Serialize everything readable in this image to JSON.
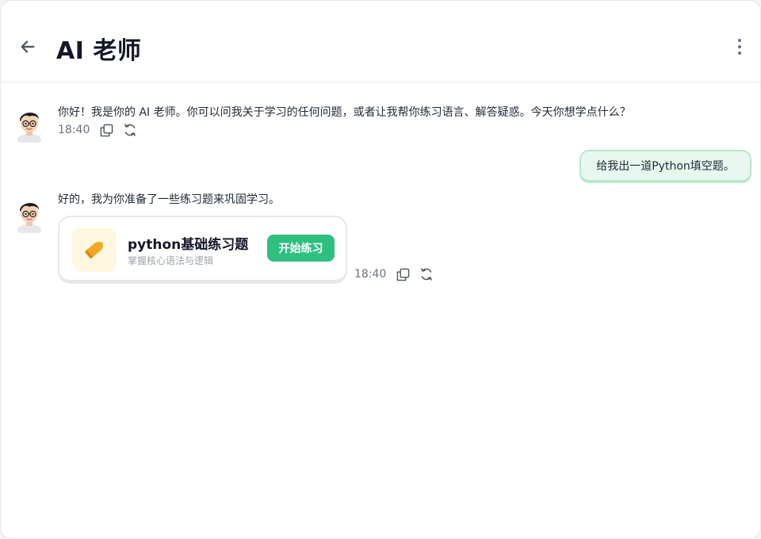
{
  "header": {
    "title": "AI 老师"
  },
  "messages": {
    "ai_1": {
      "text": "你好！我是你的 AI 老师。你可以问我关于学习的任何问题，或者让我帮你练习语言、解答疑惑。今天你想学点什么？",
      "time": "18:40"
    },
    "user_1": {
      "text": "给我出一道Python填空题。"
    },
    "ai_2": {
      "text": "好的，我为你准备了一些练习题来巩固学习。",
      "time": "18:40",
      "card": {
        "title": "python基础练习题",
        "subtitle": "掌握核心语法与逻辑",
        "button_label": "开始练习"
      }
    }
  },
  "colors": {
    "accent": "#2fbf7f",
    "user_bubble_bg": "#e8f8ee",
    "user_bubble_border": "#b9e8ca",
    "card_icon_bg": "#fff7e0",
    "pencil": "#f5a524"
  },
  "icons": {
    "back": "arrow-left-icon",
    "more": "more-vertical-icon",
    "copy": "copy-icon",
    "regenerate": "refresh-icon",
    "card": "pencil-icon"
  }
}
